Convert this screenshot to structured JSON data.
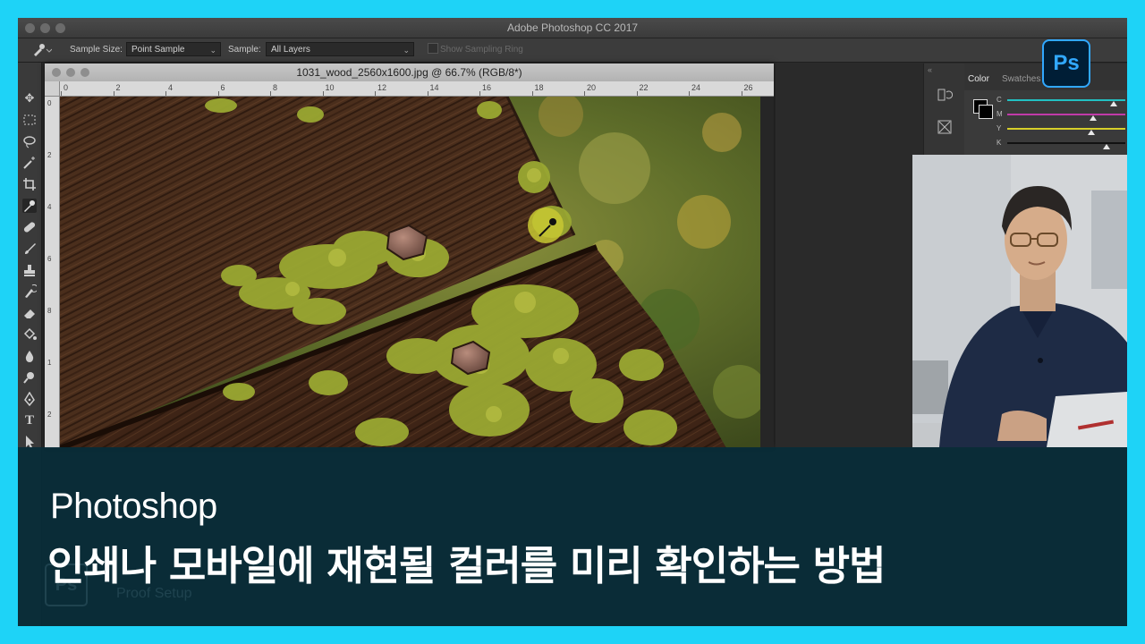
{
  "window": {
    "title": "Adobe Photoshop CC 2017"
  },
  "options_bar": {
    "sample_size_label": "Sample Size:",
    "sample_size_value": "Point Sample",
    "sample_label": "Sample:",
    "sample_value": "All Layers",
    "show_ring_label": "Show Sampling Ring"
  },
  "document": {
    "title": "1031_wood_2560x1600.jpg @ 66.7% (RGB/8*)",
    "ruler_top": [
      "0",
      "2",
      "4",
      "6",
      "8",
      "10",
      "12",
      "14",
      "16",
      "18",
      "20",
      "22",
      "24",
      "26"
    ],
    "ruler_left": [
      "0",
      "2",
      "4",
      "6",
      "8",
      "1",
      "2"
    ]
  },
  "panels": {
    "color_tab": "Color",
    "swatches_tab": "Swatches",
    "channels": [
      "C",
      "M",
      "Y",
      "K"
    ],
    "channel_levels": [
      0.9,
      0.73,
      0.71,
      0.84
    ],
    "channel_colors": [
      "#22c1c3",
      "#c13aa8",
      "#d6cf2a",
      "#111111"
    ]
  },
  "logo": {
    "text": "Ps"
  },
  "caption": {
    "subtitle": "Photoshop",
    "title": "인쇄나 모바일에 재현될 컬러를 미리 확인하는 방법",
    "ghost_text": "Proof Setup",
    "ghost_logo": "Ps"
  },
  "colors": {
    "frame_border": "#1ed3f7",
    "caption_bg": "#082c38",
    "ps_blue": "#31a8ff",
    "ps_dark": "#001e36"
  }
}
